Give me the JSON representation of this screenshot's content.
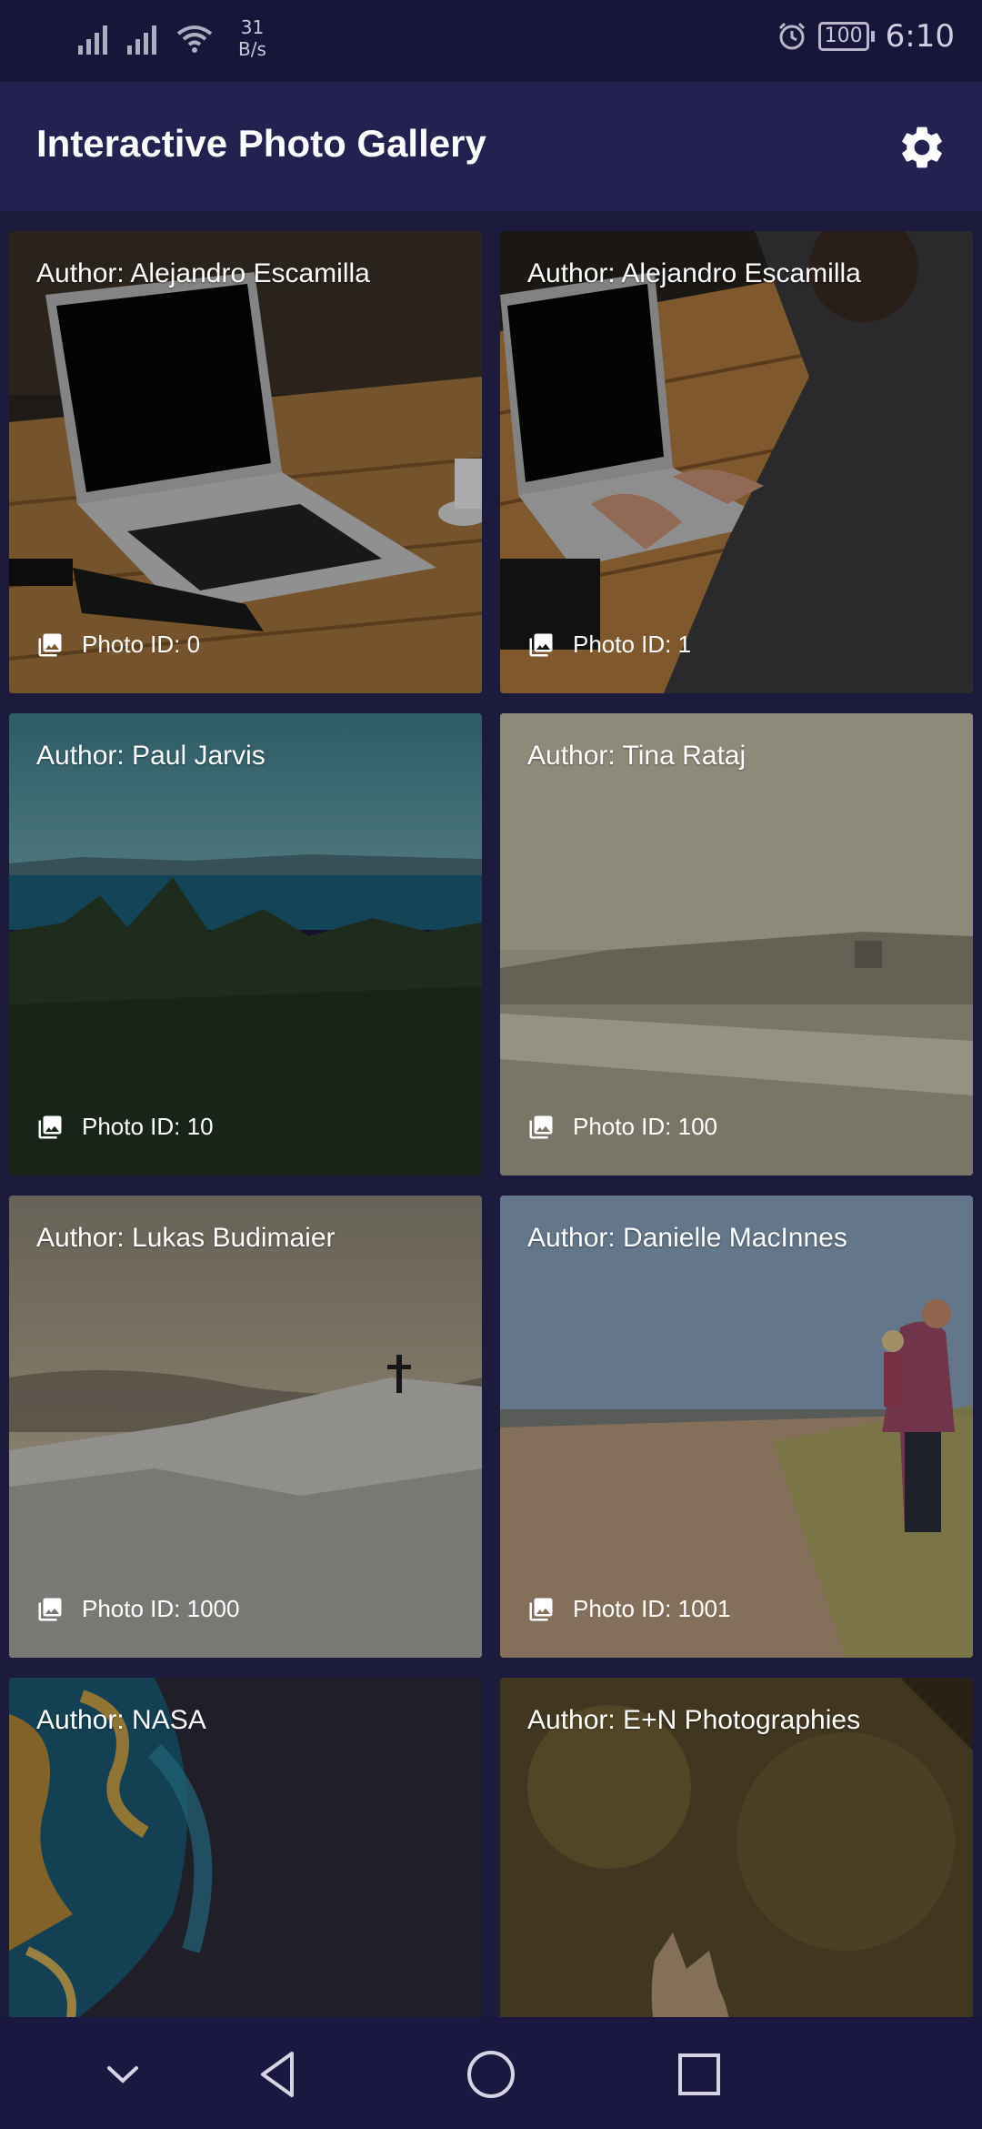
{
  "status_bar": {
    "net_speed_value": "31",
    "net_speed_unit": "B/s",
    "battery": "100",
    "time": "6:10"
  },
  "app_bar": {
    "title": "Interactive Photo Gallery",
    "settings_icon": "gear-icon"
  },
  "photos": [
    {
      "author": "Author: Alejandro Escamilla",
      "photo_id": "Photo ID: 0"
    },
    {
      "author": "Author: Alejandro Escamilla",
      "photo_id": "Photo ID: 1"
    },
    {
      "author": "Author: Paul Jarvis",
      "photo_id": "Photo ID: 10"
    },
    {
      "author": "Author: Tina Rataj",
      "photo_id": "Photo ID: 100"
    },
    {
      "author": "Author: Lukas Budimaier",
      "photo_id": "Photo ID: 1000"
    },
    {
      "author": "Author: Danielle MacInnes",
      "photo_id": "Photo ID: 1001"
    },
    {
      "author": "Author: NASA"
    },
    {
      "author": "Author: E+N Photographies"
    }
  ],
  "nav_bar": {
    "icons": [
      "chevron-down-icon",
      "back-triangle-icon",
      "home-circle-icon",
      "recents-square-icon"
    ]
  },
  "colors": {
    "background": "#1c1a3d",
    "app_bar": "#232150",
    "status_bar": "#17153a",
    "nav_bar": "#1a1840"
  }
}
